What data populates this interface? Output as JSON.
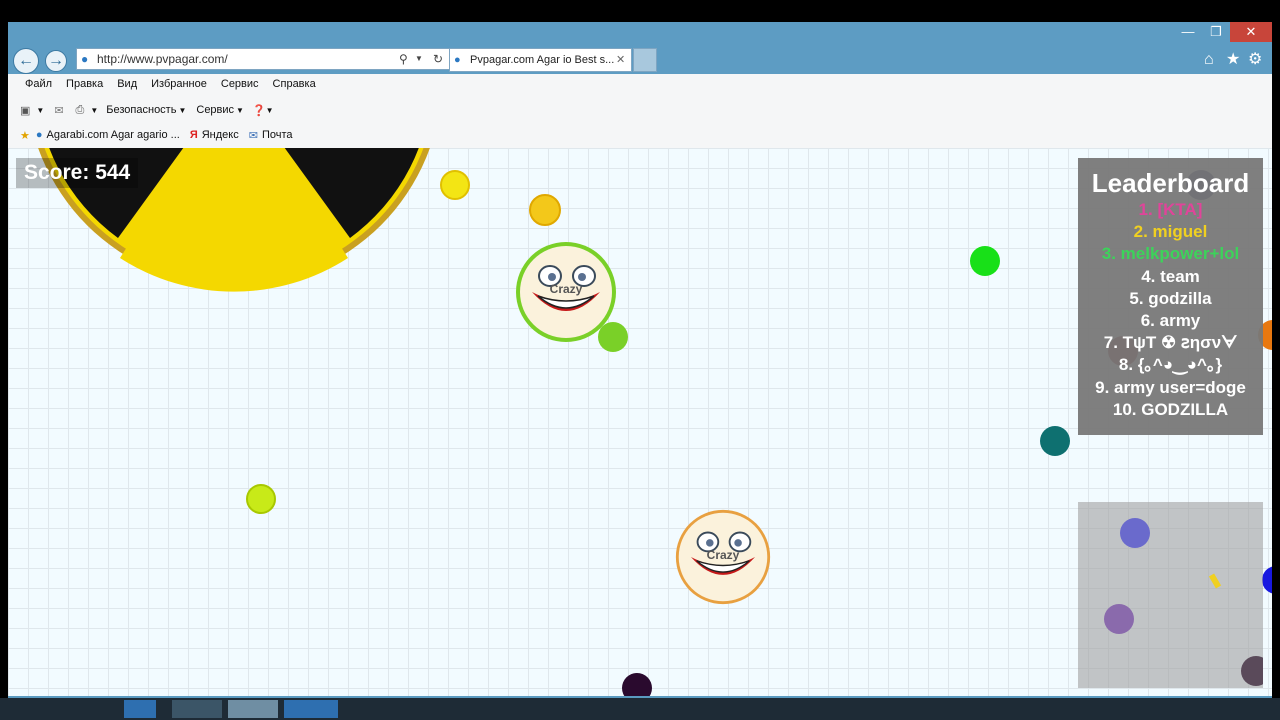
{
  "browser": {
    "address_url": "http://www.pvpagar.com/",
    "tab_title": "Pvpagar.com Agar io Best s...",
    "menu": [
      "Файл",
      "Правка",
      "Вид",
      "Избранное",
      "Сервис",
      "Справка"
    ],
    "commands": {
      "safety": "Безопасность",
      "tools": "Сервис"
    },
    "favorites": [
      "Agarabi.com Agar agario ...",
      "Яндекс",
      "Почта"
    ]
  },
  "game": {
    "score_label": "Score: 544",
    "leaderboard_title": "Leaderboard",
    "leaderboard": [
      {
        "text": "1. [KTA]",
        "color": "#e0449a"
      },
      {
        "text": "2. miguel",
        "color": "#f0d020"
      },
      {
        "text": "3. melkpower+lol",
        "color": "#3cd35a"
      },
      {
        "text": "4. team",
        "color": "#ffffff"
      },
      {
        "text": "5. godzilla",
        "color": "#ffffff"
      },
      {
        "text": "6. army",
        "color": "#ffffff"
      },
      {
        "text": "7. TψT ☢ ꙅησνᗄ",
        "color": "#ffffff"
      },
      {
        "text": "8. {｡^◕‿◕^｡}",
        "color": "#ffffff"
      },
      {
        "text": "9. army user=doge",
        "color": "#ffffff"
      },
      {
        "text": "10. GODZILLA",
        "color": "#ffffff"
      }
    ],
    "cell_names": [
      "Crazy",
      "Crazy"
    ]
  }
}
